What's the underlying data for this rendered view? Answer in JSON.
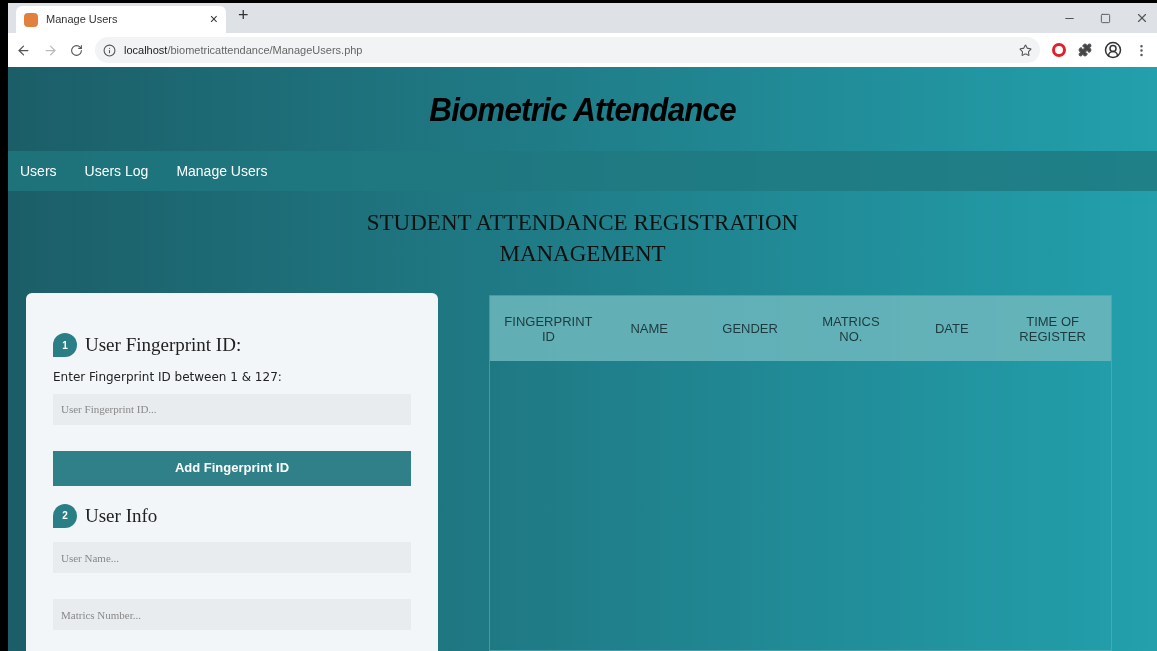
{
  "browser": {
    "tab_title": "Manage Users",
    "close": "×",
    "new_tab": "+",
    "url_host": "localhost",
    "url_path": "/biometricattendance/ManageUsers.php"
  },
  "header": {
    "title": "Biometric Attendance"
  },
  "nav": [
    {
      "label": "Users"
    },
    {
      "label": "Users Log"
    },
    {
      "label": "Manage Users"
    }
  ],
  "page_title": "STUDENT ATTENDANCE REGISTRATION MANAGEMENT",
  "form": {
    "steps": [
      {
        "number": "1",
        "title": "User Fingerprint ID:"
      },
      {
        "number": "2",
        "title": "User Info"
      }
    ],
    "fingerprint_label": "Enter Fingerprint ID between 1 & 127:",
    "fingerprint_field": {
      "placeholder": "User Fingerprint ID..."
    },
    "add_button": "Add Fingerprint ID",
    "info_fields": [
      {
        "placeholder": "User Name..."
      },
      {
        "placeholder": "Matrics Number..."
      }
    ]
  },
  "table": {
    "columns": [
      "FINGERPRINT ID",
      "NAME",
      "GENDER",
      "MATRICS NO.",
      "DATE",
      "TIME OF REGISTER"
    ]
  }
}
